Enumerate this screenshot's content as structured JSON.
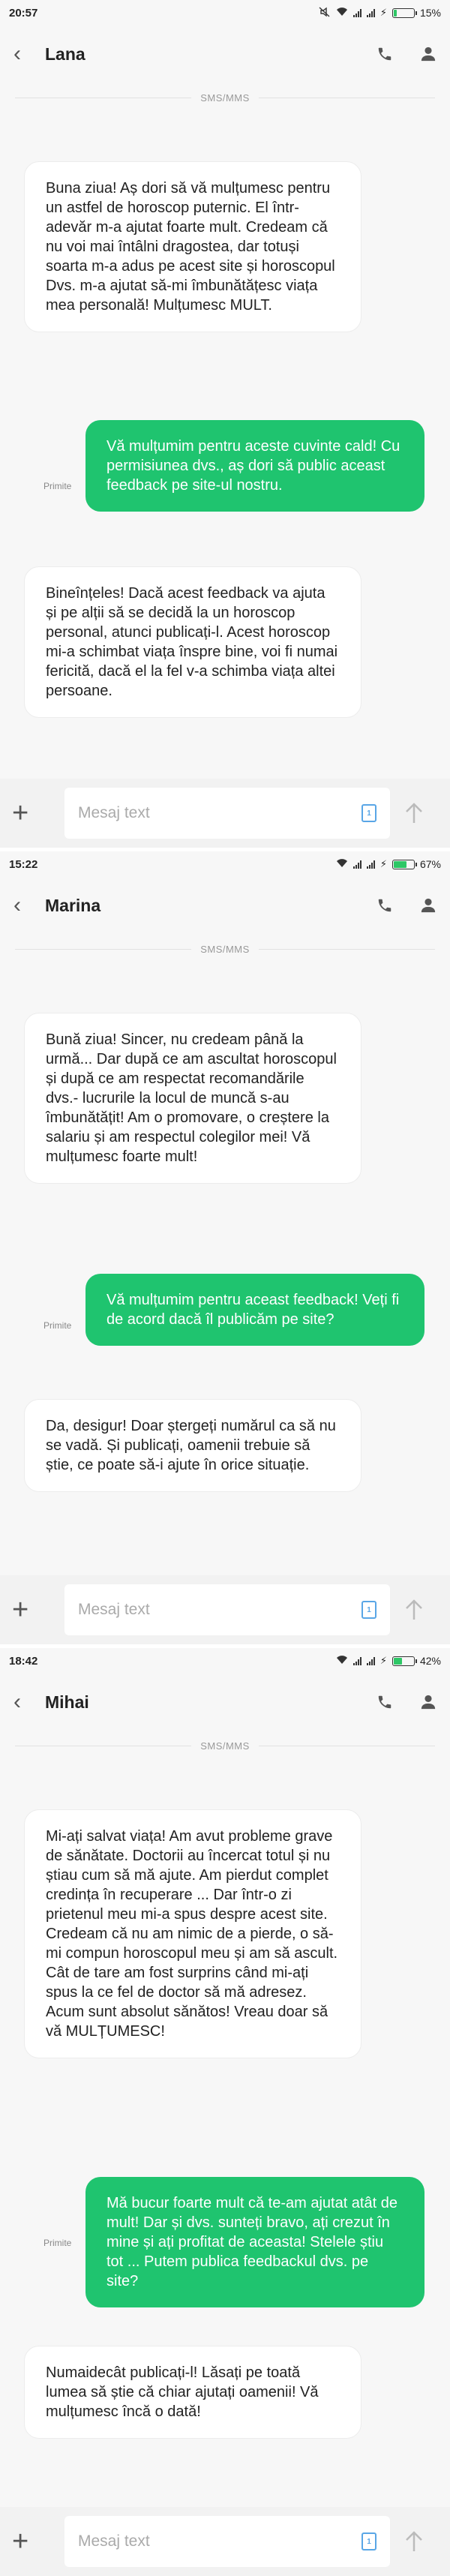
{
  "common": {
    "divider_label": "SMS/MMS",
    "input_placeholder": "Mesaj text",
    "sent_label": "Primite",
    "sim_label": "1"
  },
  "screens": [
    {
      "time": "20:57",
      "battery_percent": "15%",
      "battery_level": 0.15,
      "contact": "Lana",
      "messages": [
        {
          "dir": "in",
          "text": "Buna ziua! Aș dori să vă mulțumesc pentru un astfel de horoscop puternic. El într-adevăr m-a ajutat foarte mult. Credeam că nu voi mai întâlni dragostea, dar totuși soarta m-a adus pe acest site și horoscopul Dvs. m-a ajutat să-mi îmbunătățesc viața mea personală! Mulțumesc MULT."
        },
        {
          "dir": "out",
          "text": "Vă mulțumim pentru aceste cuvinte cald! Cu permisiunea dvs., aș dori să public aceast feedback pe site-ul nostru."
        },
        {
          "dir": "in",
          "text": "Bineînțeles! Dacă acest feedback va ajuta și pe alții să se decidă la un horoscop personal, atunci publicați-l. Acest horoscop mi-a schimbat viața înspre bine, voi fi numai fericită, dacă el la fel v-a schimba viața altei persoane."
        }
      ]
    },
    {
      "time": "15:22",
      "battery_percent": "67%",
      "battery_level": 0.67,
      "contact": "Marina",
      "messages": [
        {
          "dir": "in",
          "text": "Bună ziua! Sincer, nu credeam până la urmă... Dar după ce am ascultat horoscopul și după ce am respectat recomandările dvs.- lucrurile la locul de muncă s-au îmbunătățit! Am o promovare, o creștere la salariu și am respectul colegilor mei! Vă mulțumesc foarte mult!"
        },
        {
          "dir": "out",
          "text": "Vă mulțumim pentru aceast feedback! Veți fi de acord dacă îl publicăm pe site?"
        },
        {
          "dir": "in",
          "text": "Da, desigur! Doar ștergeți numărul ca să nu se vadă. Și publicați, oamenii trebuie să știe, ce poate să-i ajute în orice situație."
        }
      ]
    },
    {
      "time": "18:42",
      "battery_percent": "42%",
      "battery_level": 0.42,
      "contact": "Mihai",
      "messages": [
        {
          "dir": "in",
          "text": "Mi-ați salvat viața! Am avut probleme grave de sănătate. Doctorii au încercat totul și nu știau cum să mă ajute. Am pierdut complet credința în recuperare ... Dar într-o zi prietenul meu mi-a spus despre acest site. Credeam că nu am nimic de a pierde, o să-mi compun horoscopul meu și am să ascult. Cât de tare am fost surprins când mi-ați spus la ce fel de doctor să mă adresez. Acum sunt absolut sănătos! Vreau doar să vă MULȚUMESC!"
        },
        {
          "dir": "out",
          "text": "Mă bucur foarte mult că te-am ajutat atât de mult! Dar și dvs. sunteți bravo, ați crezut în mine și ați profitat de aceasta! Stelele știu tot ... Putem publica feedbackul dvs. pe site?"
        },
        {
          "dir": "in",
          "text": "Numaidecât publicați-l! Lăsați pe toată lumea să știe că chiar ajutați oamenii! Vă mulțumesc încă o dată!"
        }
      ]
    }
  ]
}
